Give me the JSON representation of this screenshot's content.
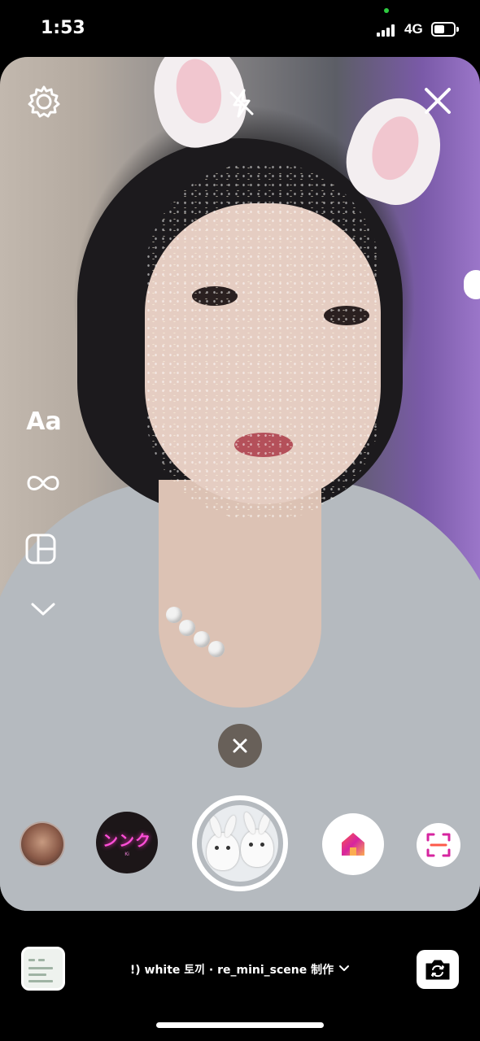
{
  "status_bar": {
    "time": "1:53",
    "network": "4G",
    "indicator_color": "#2ecc40"
  },
  "camera": {
    "top_controls": {
      "settings_icon": "gear-icon",
      "flash_icon": "flash-off-icon",
      "close_icon": "close-icon"
    },
    "tools": {
      "text_label": "Aa",
      "boomerang_icon": "infinity-icon",
      "layout_icon": "layout-grid-icon",
      "more_icon": "chevron-down-icon"
    }
  },
  "effects": {
    "dismiss_icon": "close-icon",
    "neon_effect_text": "ンンク",
    "neon_effect_subtext": "Ki",
    "neon_color": "#ff4fd8",
    "selected_effect": "white bunny",
    "home_icon": "home-icon",
    "scan_icon": "scan-icon"
  },
  "bottom_bar": {
    "effect_name": "!) white 토끼 · re_mini_scene 制作",
    "dropdown_icon": "chevron-down-icon",
    "flip_icon": "camera-flip-icon"
  }
}
